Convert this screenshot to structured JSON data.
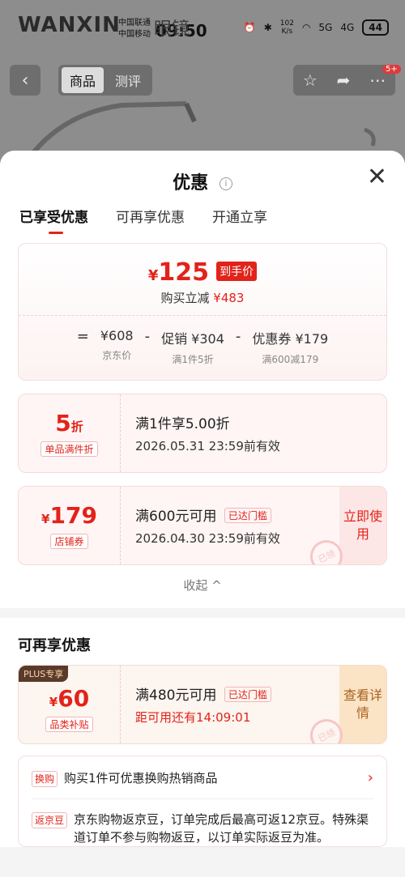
{
  "status_bar": {
    "carrier1": "中国联通",
    "carrier2": "中国移动",
    "time": "09:50",
    "speed_value": "102",
    "speed_unit": "K/s",
    "net1": "5G",
    "net2": "4G",
    "battery": "44"
  },
  "background_app": {
    "brand": "WANXIN",
    "brand_suffix": "眼镜",
    "tabs": [
      "商品",
      "测评"
    ],
    "notification_count": "5+"
  },
  "sheet": {
    "title": "优惠",
    "tabs": [
      {
        "label": "已享受优惠",
        "active": true
      },
      {
        "label": "可再享优惠",
        "active": false
      },
      {
        "label": "开通立享",
        "active": false
      }
    ],
    "summary": {
      "currency": "¥",
      "final_price": "125",
      "final_tag": "到手价",
      "saved_label": "购买立减",
      "saved_amount": "¥483",
      "formula": {
        "eq": "=",
        "minus": "-",
        "jd_price": "¥608",
        "jd_price_label": "京东价",
        "promo": "促销 ¥304",
        "promo_desc": "满1件5折",
        "coupon": "优惠券 ¥179",
        "coupon_desc": "满600减179"
      }
    },
    "coupons": [
      {
        "value": "5",
        "unit": "折",
        "tag": "单品满件折",
        "main": "满1件享5.00折",
        "sub": "2026.05.31 23:59前有效"
      },
      {
        "currency": "¥",
        "value": "179",
        "tag": "店铺券",
        "main": "满600元可用",
        "pill": "已达门槛",
        "sub": "2026.04.30 23:59前有效",
        "action": "立即使用",
        "stamp": "已领"
      }
    ],
    "collapse_label": "收起 ^",
    "more": {
      "title": "可再享优惠",
      "coupon": {
        "plus": "PLUS专享",
        "currency": "¥",
        "value": "60",
        "tag": "品类补贴",
        "main": "满480元可用",
        "pill": "已达门槛",
        "sub": "距可用还有14:09:01",
        "action": "查看详情",
        "stamp": "已领"
      },
      "items": [
        {
          "label": "换购",
          "text": "购买1件可优惠换购热销商品",
          "arrow": "›"
        },
        {
          "label": "返京豆",
          "text": "京东购物返京豆，订单完成后最高可返12京豆。特殊渠道订单不参与购物返豆，以订单实际返豆为准。"
        }
      ]
    }
  }
}
